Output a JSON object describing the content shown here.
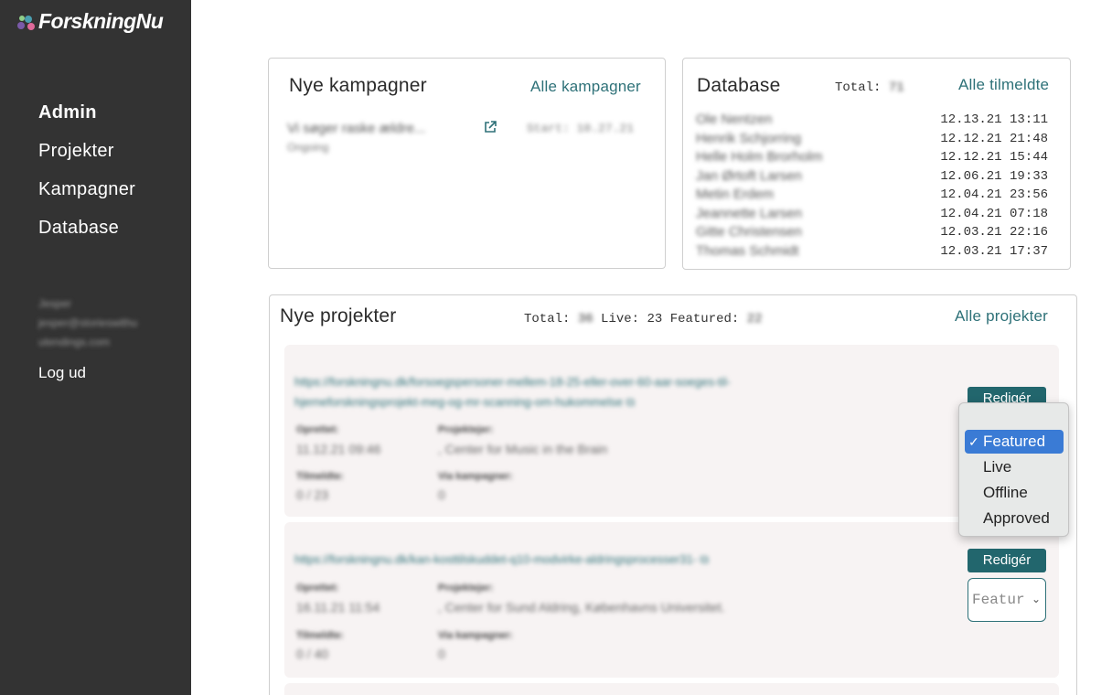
{
  "brand": {
    "name": "ForskningNu",
    "dot_colors": [
      "#7a5aa8",
      "#4a9fb0",
      "#e06a9a",
      "#8fcf8a"
    ]
  },
  "sidebar": {
    "items": [
      {
        "label": "Admin",
        "active": true
      },
      {
        "label": "Projekter"
      },
      {
        "label": "Kampagner"
      },
      {
        "label": "Database"
      }
    ],
    "user_name": "Jesper",
    "user_email_line1": "jesper@storieswithu",
    "user_email_line2": "utendings.com",
    "logout": "Log ud"
  },
  "campaigns": {
    "title": "Nye kampagner",
    "link": "Alle kampagner",
    "item": {
      "name": "Vi søger raske ældre...",
      "status": "Ongoing",
      "start": "Start: 10.27.21"
    }
  },
  "database": {
    "title": "Database",
    "total_label": "Total:",
    "total_value": "71",
    "link": "Alle tilmeldte",
    "entries": [
      {
        "name": "Ole Nentzen",
        "date": "12.13.21 13:11"
      },
      {
        "name": "Henrik Schjorring",
        "date": "12.12.21 21:48"
      },
      {
        "name": "Helle Holm Brorholm",
        "date": "12.12.21 15:44"
      },
      {
        "name": "Jan Ørtoft Larsen",
        "date": "12.06.21 19:33"
      },
      {
        "name": "Metin Erdem",
        "date": "12.04.21 23:56"
      },
      {
        "name": "Jeannette Larsen",
        "date": "12.04.21 07:18"
      },
      {
        "name": "Gitte Christensen",
        "date": "12.03.21 22:16"
      },
      {
        "name": "Thomas Schmidt",
        "date": "12.03.21 17:37"
      }
    ]
  },
  "projects": {
    "title": "Nye projekter",
    "total_label": "Total:",
    "total_value": "36",
    "live_label": "Live:",
    "live_value": "23",
    "featured_label": "Featured:",
    "featured_value": "22",
    "link": "Alle projekter",
    "labels": {
      "created": "Oprettet:",
      "owner": "Projektejer:",
      "signups": "Tilmeldte:",
      "via": "Via kampagner:"
    },
    "items": [
      {
        "url_line1": "https://forskningnu.dk/forsoegspersoner-mellem-18-25-eller-over-60-aar-soeges-til-",
        "url_line2": "hjerneforskningsprojekt-meg-og-mr-scanning-om-hukommelse",
        "created": "11.12.21 09:46",
        "owner": ", Center for Music in the Brain",
        "signups": "0 / 23",
        "via": "0",
        "edit": "Redigér"
      },
      {
        "url_line1": "https://forskningnu.dk/kan-kosttilskuddet-q10-modvirke-aldringsprocesser31-",
        "created": "16.11.21 11:54",
        "owner": ", Center for Sund Aldring, Københavns Universitet.",
        "signups": "0 / 40",
        "via": "0",
        "edit": "Redigér",
        "status_value": "Featur"
      }
    ]
  },
  "status_dropdown": {
    "options": [
      "Featured",
      "Live",
      "Offline",
      "Approved"
    ],
    "selected": "Featured",
    "check": "✓"
  },
  "colors": {
    "accent": "#2e7178",
    "button": "#22666d",
    "sidebar": "#333333",
    "selection": "#3a7bd5"
  }
}
